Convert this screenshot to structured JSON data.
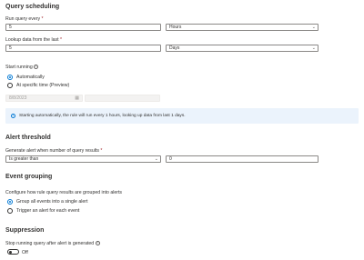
{
  "scheduling": {
    "title": "Query scheduling",
    "run_every_label": "Run query every",
    "run_every_value": "5",
    "run_every_unit": "Hours",
    "lookup_label": "Lookup data from the last",
    "lookup_value": "5",
    "lookup_unit": "Days",
    "start_running_label": "Start running",
    "radio_auto": "Automatically",
    "radio_specific": "At specific time (Preview)",
    "date_value": "8/8/2023",
    "info_text": "Starting automatically, the rule will run every 1 hours, looking up data from last 1 days."
  },
  "threshold": {
    "title": "Alert threshold",
    "label": "Generate alert when number of query results",
    "operator": "Is greater than",
    "value": "0"
  },
  "grouping": {
    "title": "Event grouping",
    "description": "Configure how rule query results are grouped into alerts",
    "option_single": "Group all events into a single alert",
    "option_each": "Trigger an alert for each event"
  },
  "suppression": {
    "title": "Suppression",
    "label": "Stop running query after alert is generated",
    "toggle_state": "Off"
  },
  "colors": {
    "accent": "#0078d4",
    "info_banner": "#ebf3fc",
    "required": "#a4262c"
  },
  "icons": {
    "chevron": "chevron-down-icon",
    "info": "info-icon",
    "calendar": "calendar-icon"
  }
}
